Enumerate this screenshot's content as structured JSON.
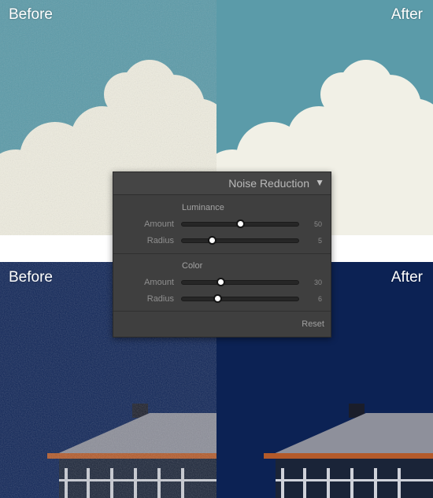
{
  "labels": {
    "top_left": "Before",
    "top_right": "After",
    "bottom_left": "Before",
    "bottom_right": "After"
  },
  "colors": {
    "sky_top": "#5a9aa8",
    "sky_bottom": "#0c2254",
    "cloud": "#f1f0e8",
    "roof": "#8b8d98",
    "roof_trim": "#b35a2a",
    "panel_bg": "#3f3f3f",
    "slider_thumb": "#ffffff"
  },
  "panel": {
    "title": "Noise Reduction",
    "toggle_icon": "triangle-down-icon",
    "luminance": {
      "label": "Luminance",
      "amount_label": "Amount",
      "amount_value": "50",
      "amount_fraction": 0.5,
      "radius_label": "Radius",
      "radius_value": "5",
      "radius_fraction": 0.24
    },
    "color": {
      "label": "Color",
      "amount_label": "Amount",
      "amount_value": "30",
      "amount_fraction": 0.32,
      "radius_label": "Radius",
      "radius_value": "6",
      "radius_fraction": 0.29
    },
    "reset_label": "Reset"
  }
}
